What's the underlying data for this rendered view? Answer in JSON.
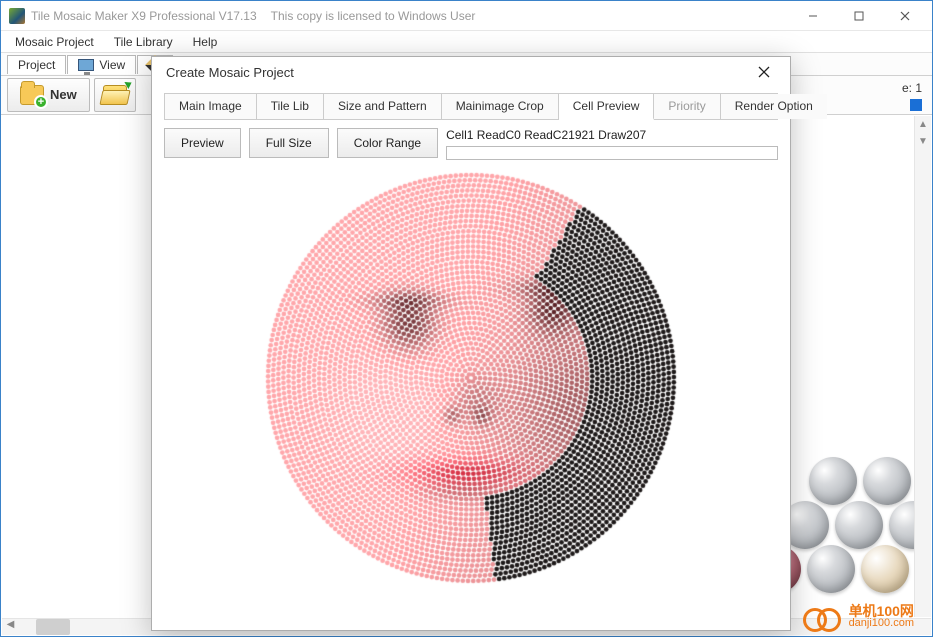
{
  "titlebar": {
    "app_title": "Tile Mosaic Maker X9 Professional V17.13",
    "license_note": "This copy is licensed to Windows User"
  },
  "menubar": {
    "items": [
      "Mosaic Project",
      "Tile Library",
      "Help"
    ]
  },
  "toolbar": {
    "tabs": {
      "project": "Project",
      "view": "View"
    },
    "buttons": {
      "new": "New"
    },
    "frame_label": "e: 1"
  },
  "dialog": {
    "title": "Create Mosaic Project",
    "tabs": {
      "main_image": "Main Image",
      "tile_lib": "Tile Lib",
      "size_pattern": "Size and Pattern",
      "mainimage_crop": "Mainimage Crop",
      "cell_preview": "Cell Preview",
      "priority": "Priority",
      "render_option": "Render Option"
    },
    "active_tab": "cell_preview",
    "buttons": {
      "preview": "Preview",
      "full_size": "Full Size",
      "color_range": "Color Range"
    },
    "status_text": "Cell1 ReadC0 ReadC21921  Draw207"
  },
  "watermark": {
    "line1": "单机100网",
    "line2": "danji100.com"
  }
}
